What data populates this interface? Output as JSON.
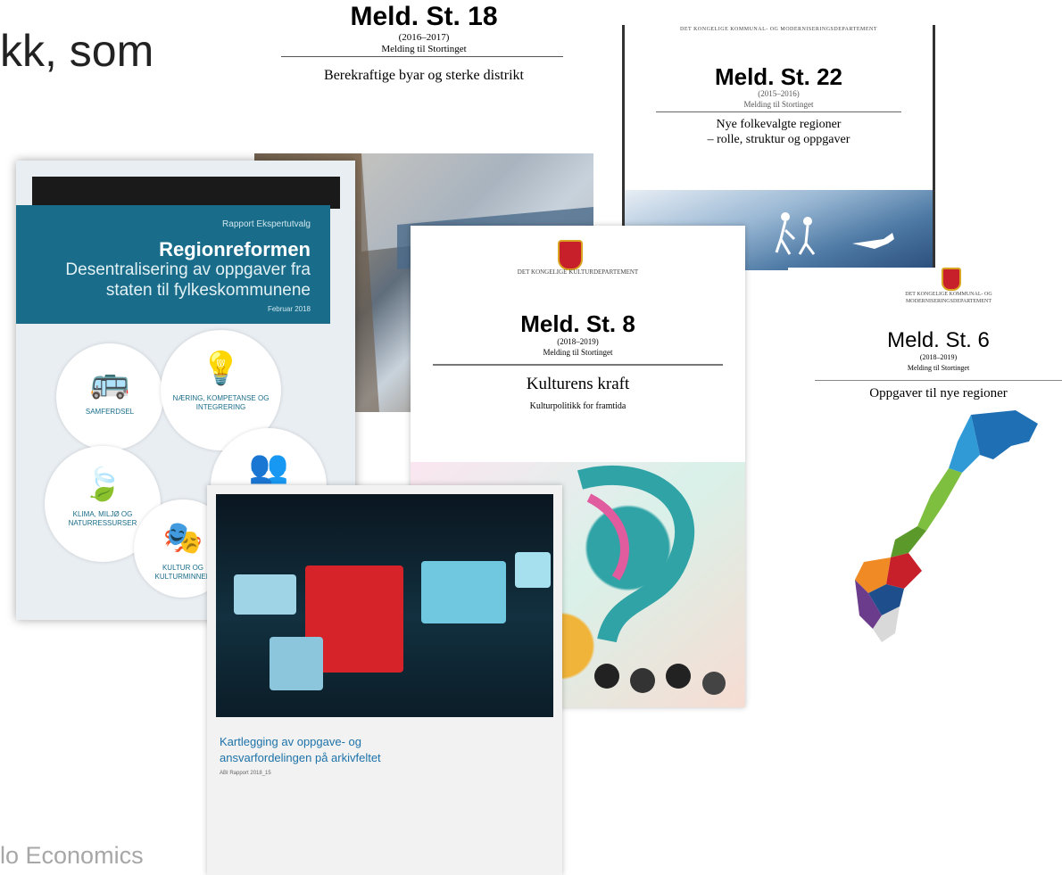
{
  "slide": {
    "title_fragment": "kk, som",
    "footer": "lo Economics"
  },
  "covers": {
    "meld18": {
      "number": "Meld. St. 18",
      "years": "(2016–2017)",
      "subtitle": "Melding til Stortinget",
      "title": "Berekraftige byar og sterke distrikt"
    },
    "meld22": {
      "department": "DET KONGELIGE KOMMUNAL- OG MODERNISERINGSDEPARTEMENT",
      "number": "Meld. St. 22",
      "years": "(2015–2016)",
      "subtitle": "Melding til Stortinget",
      "title_line1": "Nye folkevalgte regioner",
      "title_line2": "– rolle, struktur og oppgaver"
    },
    "regionreformen": {
      "publisher": "Rapport Ekspertutvalg",
      "title": "Regionreformen",
      "subtitle_line1": "Desentralisering av oppgaver fra",
      "subtitle_line2": "staten til fylkeskommunene",
      "date": "Februar 2018",
      "circles": [
        {
          "icon": "bus-icon",
          "glyph": "🚌",
          "label": "SAMFERDSEL"
        },
        {
          "icon": "lightbulb-icon",
          "glyph": "💡",
          "label": "NÆRING, KOMPETANSE OG INTEGRERING"
        },
        {
          "icon": "leaf-icon",
          "glyph": "🍃",
          "label": "KLIMA, MILJØ OG NATURRESSURSER"
        },
        {
          "icon": "theatre-mask-icon",
          "glyph": "🎭",
          "label": "KULTUR OG KULTURMINNER"
        },
        {
          "icon": "people-icon",
          "glyph": "👥",
          "label": ""
        }
      ]
    },
    "meld8": {
      "department": "DET KONGELIGE KULTURDEPARTEMENT",
      "number": "Meld. St. 8",
      "years": "(2018–2019)",
      "subtitle": "Melding til Stortinget",
      "title": "Kulturens kraft",
      "subtitle2": "Kulturpolitikk for framtida"
    },
    "meld6": {
      "department": "DET KONGELIGE KOMMUNAL- OG MODERNISERINGSDEPARTEMENT",
      "number": "Meld. St. 6",
      "years": "(2018–2019)",
      "subtitle": "Melding til Stortinget",
      "title": "Oppgaver til nye regioner"
    },
    "arkiv": {
      "title_line1": "Kartlegging av oppgave- og",
      "title_line2": "ansvarfordelingen på arkivfeltet",
      "report": "ABI Rapport 2018_15"
    }
  },
  "colors": {
    "regionreformen_band": "#1a6d8a",
    "arkiv_title": "#1d72a8",
    "map_colors": [
      "#1f6fb4",
      "#2f9ad6",
      "#7fbf3f",
      "#c8202a",
      "#f08a24",
      "#6b3b8c",
      "#1f4e8c",
      "#d9d9d9"
    ]
  }
}
